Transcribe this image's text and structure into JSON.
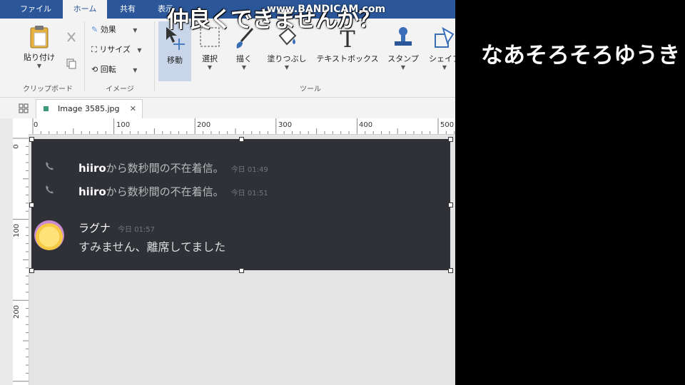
{
  "tabs": [
    "ファイル",
    "ホーム",
    "共有",
    "表示"
  ],
  "ribbon": {
    "paste_label": "貼り付け",
    "effects_label": "効果",
    "resize_label": "リサイズ",
    "rotate_label": "回転",
    "clipboard_group": "クリップボード",
    "image_group": "イメージ",
    "tools_group": "ツール",
    "move_label": "移動",
    "select_label": "選択",
    "draw_label": "描く",
    "fill_label": "塗りつぶし",
    "textbox_label": "テキストボックス",
    "stamp_label": "スタンプ",
    "shape_label": "シェイプ"
  },
  "document_tab": {
    "name": "Image 3585.jpg"
  },
  "ruler": {
    "h_ticks": [
      "0",
      "100",
      "200",
      "300",
      "400",
      "500"
    ],
    "v_ticks": [
      "0",
      "100",
      "200"
    ]
  },
  "chat": {
    "missed_calls": [
      {
        "user": "hiiro",
        "text": "から数秒間の不在着信。",
        "time": "今日 01:49"
      },
      {
        "user": "hiiro",
        "text": "から数秒間の不在着信。",
        "time": "今日 01:51"
      }
    ],
    "message": {
      "author": "ラグナ",
      "time": "今日 01:57",
      "content": "すみません、離席してました"
    }
  },
  "overlay": {
    "title": "仲良くできませんか？",
    "watermark": "www.BANDICAM.com",
    "side_comment": "なあそろそろゆうき"
  },
  "colors": {
    "tabbar": "#2b579a",
    "chat_bg": "#2f3136",
    "page_bg": "#000000"
  }
}
